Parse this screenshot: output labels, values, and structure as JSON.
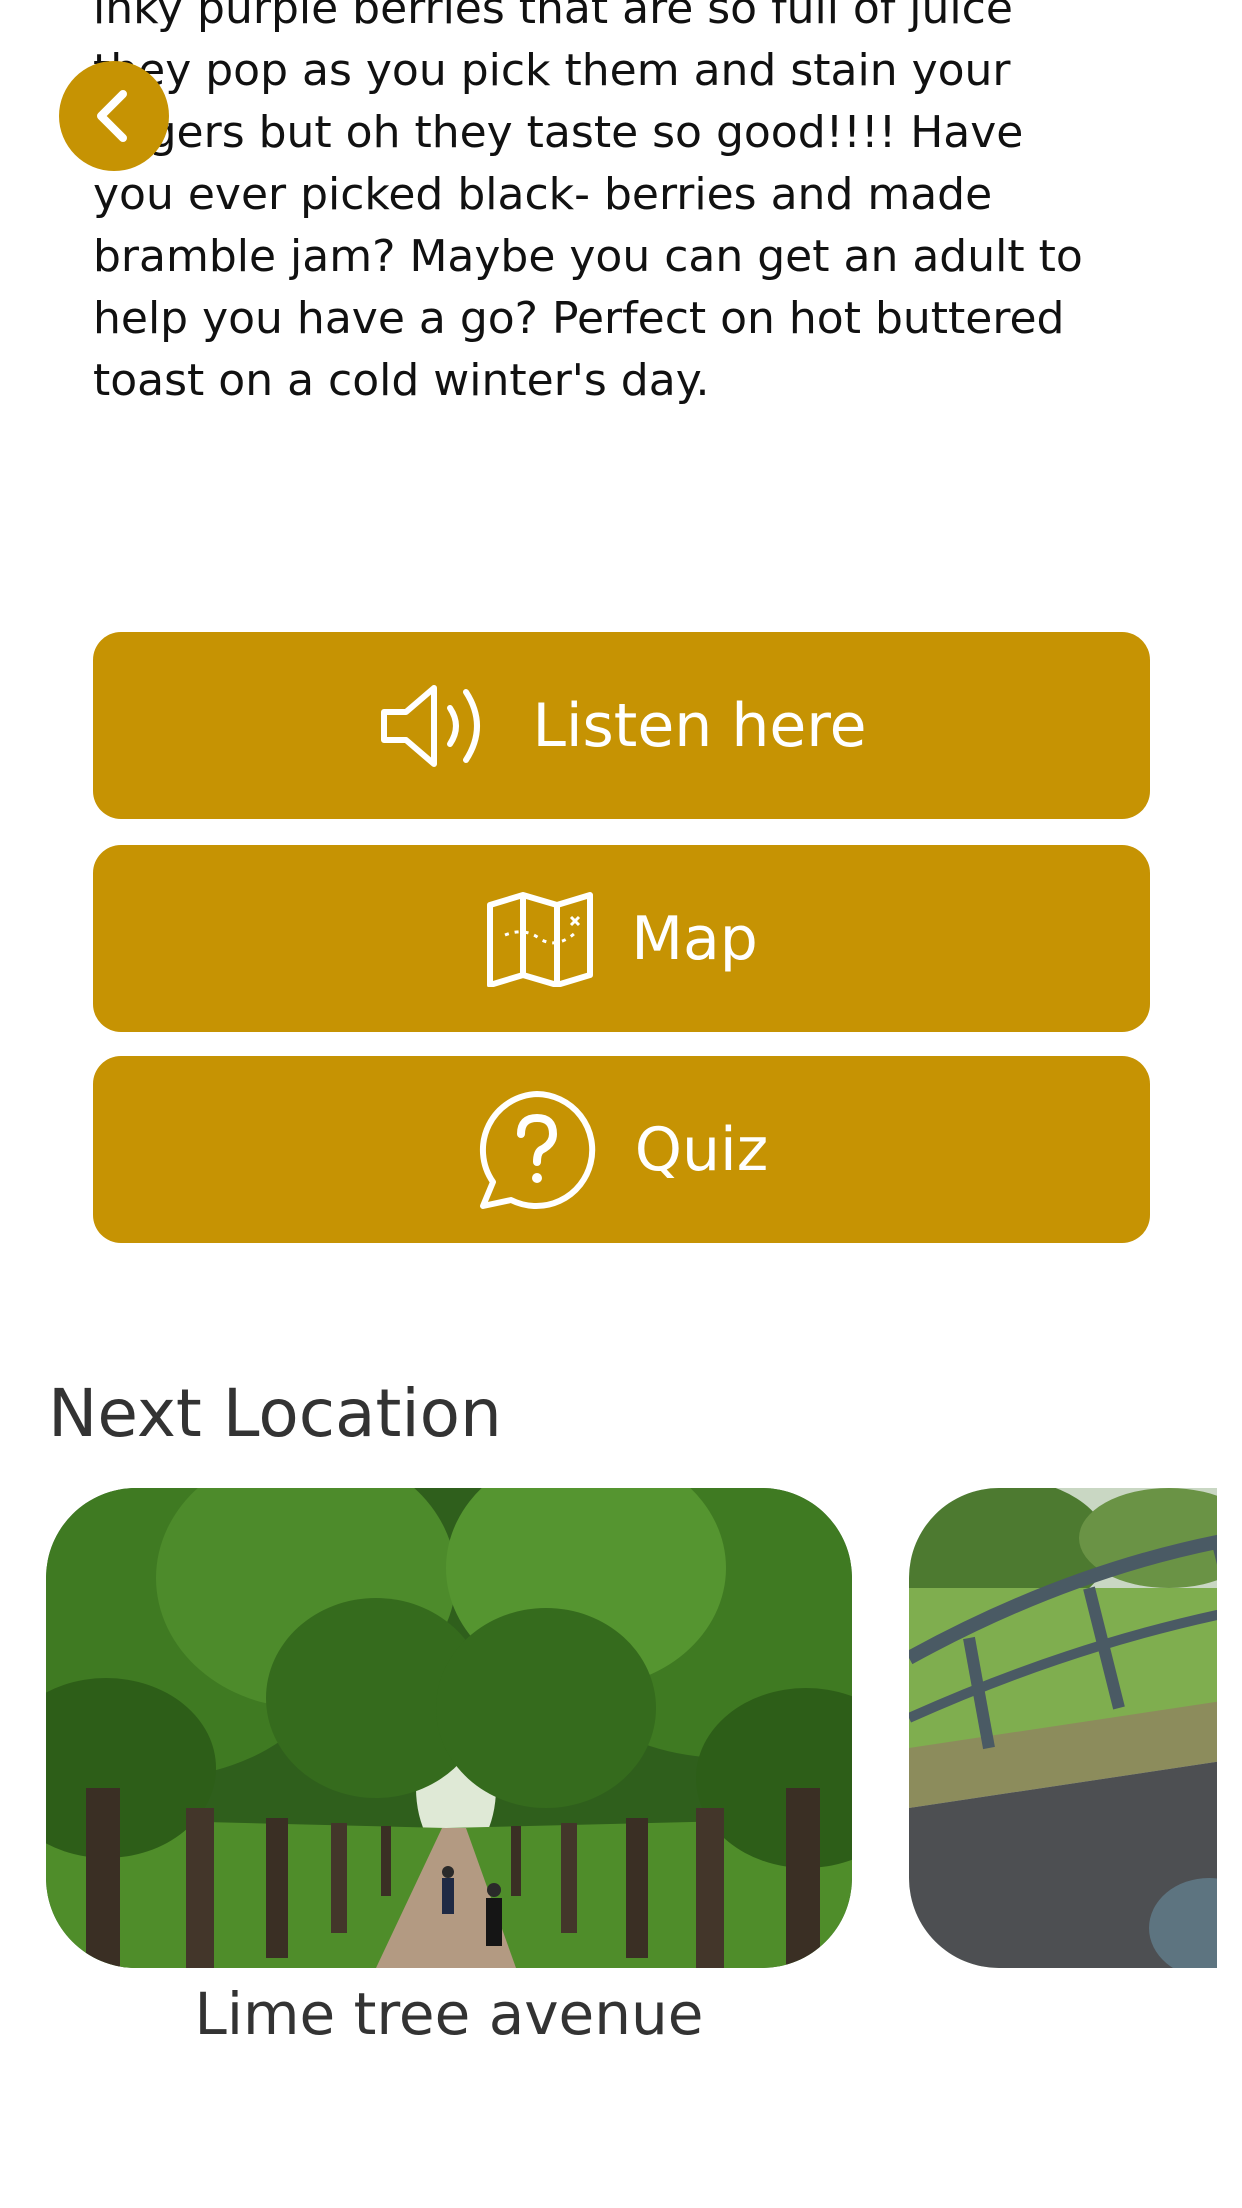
{
  "story": {
    "text": "inky purple berries that are so full of juice\nthey pop as you pick them and stain your\nfingers but oh they taste so good!!!! Have\nyou ever picked black- berries and made\nbramble jam? Maybe you can get an adult to\nhelp you have a go? Perfect on hot buttered\ntoast on a cold winter's day."
  },
  "actions": {
    "listen_label": "Listen here",
    "map_label": "Map",
    "quiz_label": "Quiz"
  },
  "next_location": {
    "title": "Next Location",
    "cards": [
      {
        "caption": "Lime tree avenue"
      },
      {
        "caption": ""
      }
    ]
  },
  "icons": {
    "back": "chevron-left-icon",
    "listen": "speaker-icon",
    "map": "folded-map-icon",
    "quiz": "question-bubble-icon"
  },
  "colors": {
    "accent": "#C69303",
    "text": "#111111",
    "heading": "#333333"
  }
}
